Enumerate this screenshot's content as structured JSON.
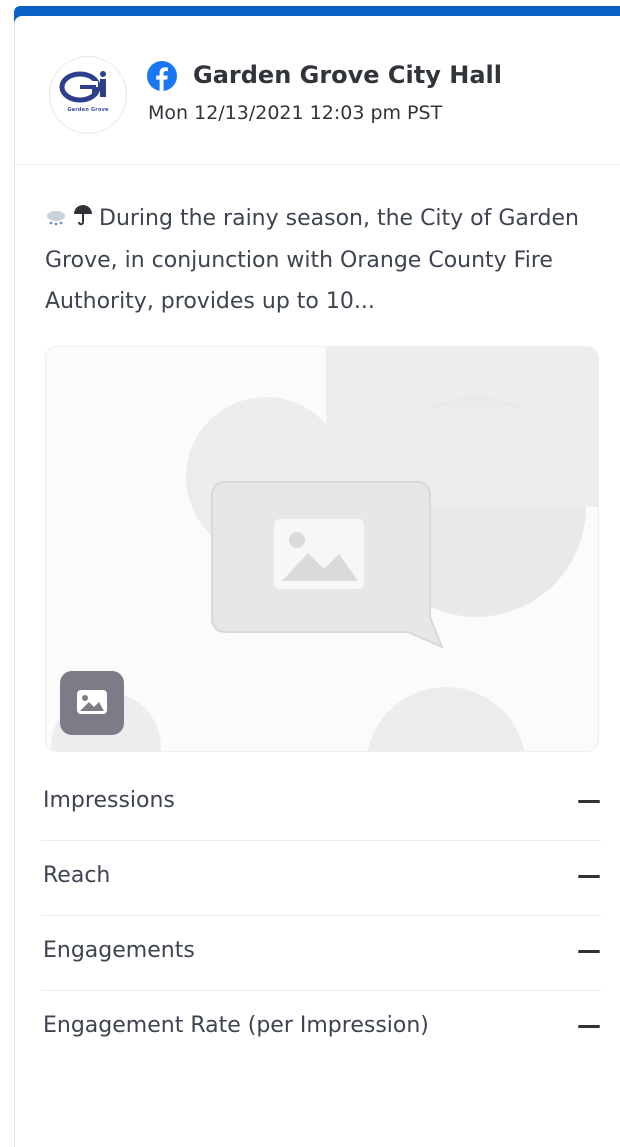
{
  "post": {
    "page_name": "Garden Grove City Hall",
    "timestamp": "Mon 12/13/2021 12:03 pm PST",
    "network_icon": "facebook-icon",
    "avatar_caption": "Garden Grove",
    "text": "During the rainy season, the City of Garden Grove, in conjunction with Orange County Fire Authority, provides up to 10...",
    "emoji": [
      "rain-cloud-icon",
      "umbrella-icon"
    ],
    "media_placeholder_icon": "image-placeholder-icon",
    "media_badge_icon": "image-icon"
  },
  "metrics": [
    {
      "label": "Impressions",
      "value": "—"
    },
    {
      "label": "Reach",
      "value": "—"
    },
    {
      "label": "Engagements",
      "value": "—"
    },
    {
      "label": "Engagement Rate (per Impression)",
      "value": "—"
    }
  ],
  "colors": {
    "accent_bar": "#0a63c4",
    "facebook": "#1877f2",
    "text": "#3d4450",
    "badge": "#7d7b86"
  }
}
